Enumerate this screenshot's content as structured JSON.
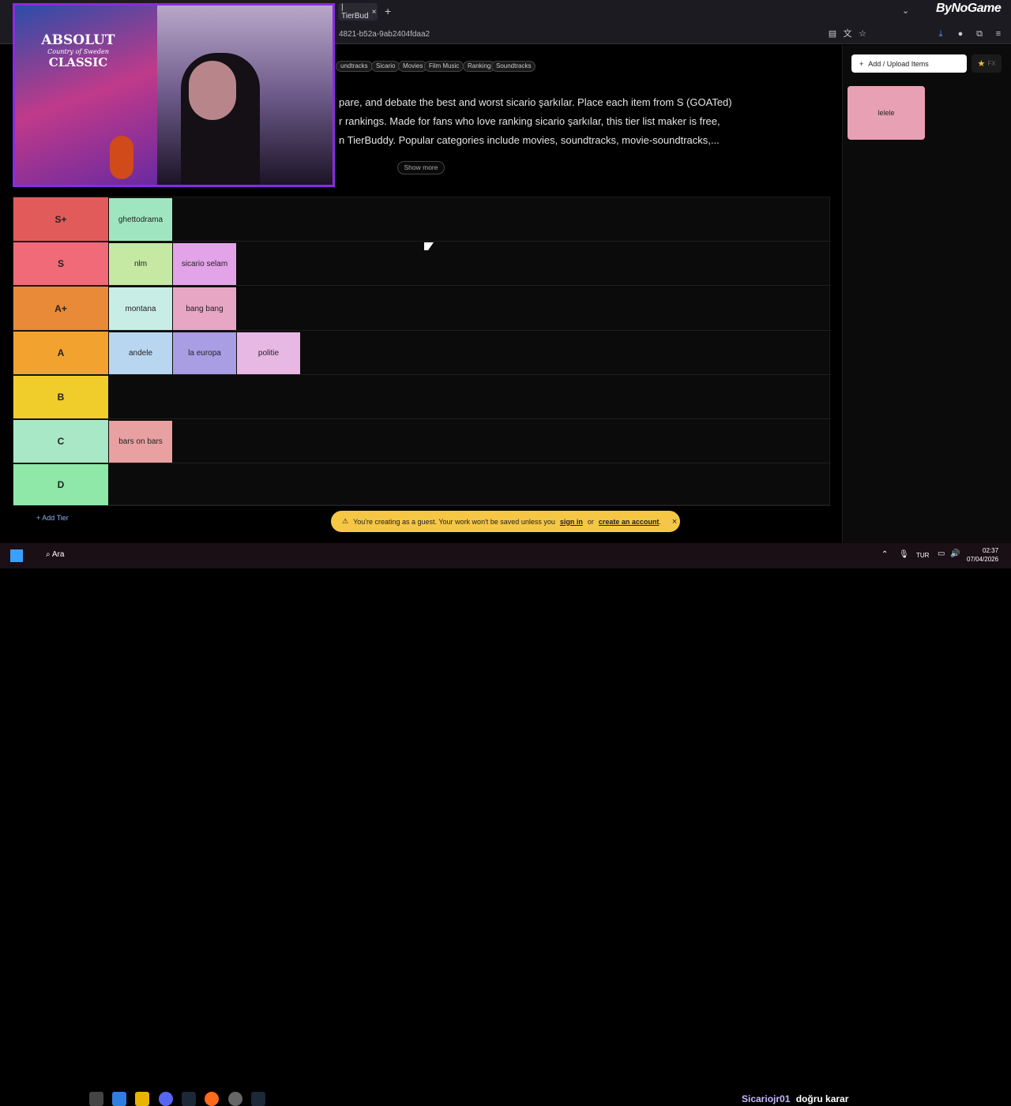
{
  "browser": {
    "tab_title": "| TierBud",
    "url": "4821-b52a-9ab2404fdaa2",
    "brand": "ByNoGame"
  },
  "tags": [
    "undtracks",
    "Sicario",
    "Movies",
    "Film Music",
    "Ranking",
    "Soundtracks"
  ],
  "description": {
    "line1": "pare, and debate the best and worst sicario şarkılar. Place each item from S (GOATed)",
    "line2": "r rankings. Made for fans who love ranking sicario şarkılar, this tier list maker is free,",
    "line3": "n TierBuddy. Popular categories include movies, soundtracks, movie-soundtracks,...",
    "show_more": "Show more"
  },
  "tiers": [
    {
      "label": "S+",
      "color": "#e25b5b",
      "items": [
        {
          "name": "ghettodrama",
          "color": "#9fe6c0"
        }
      ]
    },
    {
      "label": "S",
      "color": "#f06a78",
      "items": [
        {
          "name": "nlm",
          "color": "#c5e8a3"
        },
        {
          "name": "sicario selam",
          "color": "#e3a3e8"
        }
      ]
    },
    {
      "label": "A+",
      "color": "#e88a38",
      "items": [
        {
          "name": "montana",
          "color": "#c8ece6"
        },
        {
          "name": "bang bang",
          "color": "#e6a6c4"
        }
      ]
    },
    {
      "label": "A",
      "color": "#f1a22f",
      "items": [
        {
          "name": "andele",
          "color": "#b8d6f0"
        },
        {
          "name": "la europa",
          "color": "#a99de4"
        },
        {
          "name": "politie",
          "color": "#e8b8e4"
        }
      ]
    },
    {
      "label": "B",
      "color": "#f0cd2b",
      "items": []
    },
    {
      "label": "C",
      "color": "#a8e8c6",
      "items": [
        {
          "name": "bars on bars",
          "color": "#e8a0a0"
        }
      ]
    },
    {
      "label": "D",
      "color": "#8fe8a8",
      "items": []
    }
  ],
  "add_tier": "Add Tier",
  "side": {
    "add_upload": "Add / Upload Items",
    "fx": "FX",
    "pool_item": "lelele"
  },
  "toast": {
    "text1": "You're creating as a guest. Your work won't be saved unless you",
    "sign_in": "sign in",
    "or": "or",
    "create": "create an account",
    "dot": "."
  },
  "taskbar": {
    "search": "Ara",
    "overlay_user": "Sicariojr01",
    "overlay_msg": "doğru karar",
    "lang": "TUR",
    "time": "02:37",
    "date": "07/04/2026"
  },
  "webcam": {
    "bottle_line1": "ABSOLUT",
    "bottle_line2": "Country of Sweden",
    "bottle_line3": "CLASSIC"
  }
}
